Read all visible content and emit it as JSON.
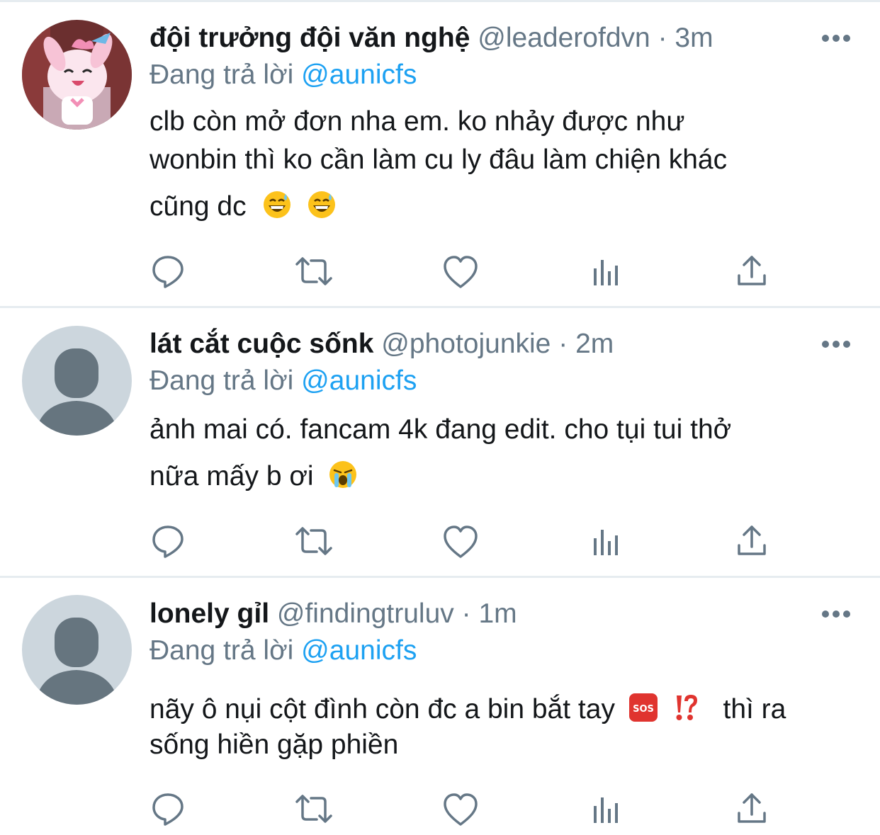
{
  "tweets": [
    {
      "name": "đội trưởng đội văn nghệ",
      "handle": "@leaderofdvn",
      "separator": "·",
      "time": "3m",
      "reply_prefix": "Đang trả lời",
      "reply_to": "@aunicfs",
      "lines": [
        "clb còn mở đơn nha em. ko nhảy được như",
        "wonbin thì ko cần làm cu ly đâu làm chiện khác",
        "cũng dc"
      ],
      "emojis": [
        "grinning-sweat-emoji",
        "grinning-sweat-emoji"
      ],
      "avatar": "anime-pony-avatar"
    },
    {
      "name": "lát cắt cuộc sốnk",
      "handle": "@photojunkie",
      "separator": "·",
      "time": "2m",
      "reply_prefix": "Đang trả lời",
      "reply_to": "@aunicfs",
      "lines": [
        "ảnh mai có. fancam 4k đang edit. cho tụi tui thở",
        "nữa mấy b ơi"
      ],
      "emojis": [
        "loudly-crying-emoji"
      ],
      "avatar": "default-avatar"
    },
    {
      "name": "lonely gỉl",
      "handle": "@findingtruluv",
      "separator": "·",
      "time": "1m",
      "reply_prefix": "Đang trả lời",
      "reply_to": "@aunicfs",
      "lines": [
        "nãy ô nụi cột đình còn đc a bin bắt tay",
        "thì ra",
        "sống hiền gặp phiền"
      ],
      "emojis": [
        "sos-emoji",
        "exclamation-question-emoji"
      ],
      "sos_text": "SOS",
      "avatar": "default-avatar"
    }
  ],
  "icons": {
    "reply": "reply-icon",
    "retweet": "retweet-icon",
    "like": "like-icon",
    "analytics": "analytics-icon",
    "share": "share-icon",
    "more": "more-icon"
  },
  "colors": {
    "name": "#14171a",
    "secondary": "#657786",
    "mention": "#1da1f2",
    "divider": "#e6ecf0",
    "icon": "#657786",
    "default_avatar_bg": "#ccd6dd",
    "default_avatar_fg": "#66757f"
  }
}
